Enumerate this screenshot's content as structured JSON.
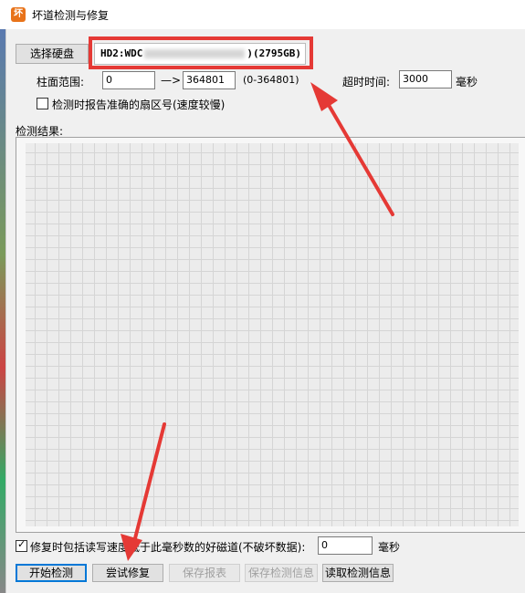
{
  "window": {
    "title": "坏道检测与修复",
    "icon_label": "坏"
  },
  "disk": {
    "select_button": "选择硬盘",
    "name_prefix": "HD2:WDC",
    "name_suffix": ")(2795GB)"
  },
  "range": {
    "label": "柱面范围:",
    "from_value": "0",
    "arrow": "—>",
    "to_value": "364801",
    "hint": "(0-364801)"
  },
  "timeout": {
    "label": "超时时间:",
    "value": "3000",
    "unit": "毫秒"
  },
  "report_sector": {
    "checked": false,
    "label": "检测时报告准确的扇区号(速度较慢)"
  },
  "results": {
    "label": "检测结果:"
  },
  "repair_option": {
    "checked": true,
    "label": "修复时包括读写速度低于此毫秒数的好磁道(不破坏数据):",
    "value": "0",
    "unit": "毫秒"
  },
  "buttons": {
    "start": "开始检测",
    "try_repair": "尝试修复",
    "save_report": "保存报表",
    "save_info": "保存检测信息",
    "load_info": "读取检测信息"
  },
  "colors": {
    "annotation": "#e53935",
    "accent": "#0078d7"
  }
}
